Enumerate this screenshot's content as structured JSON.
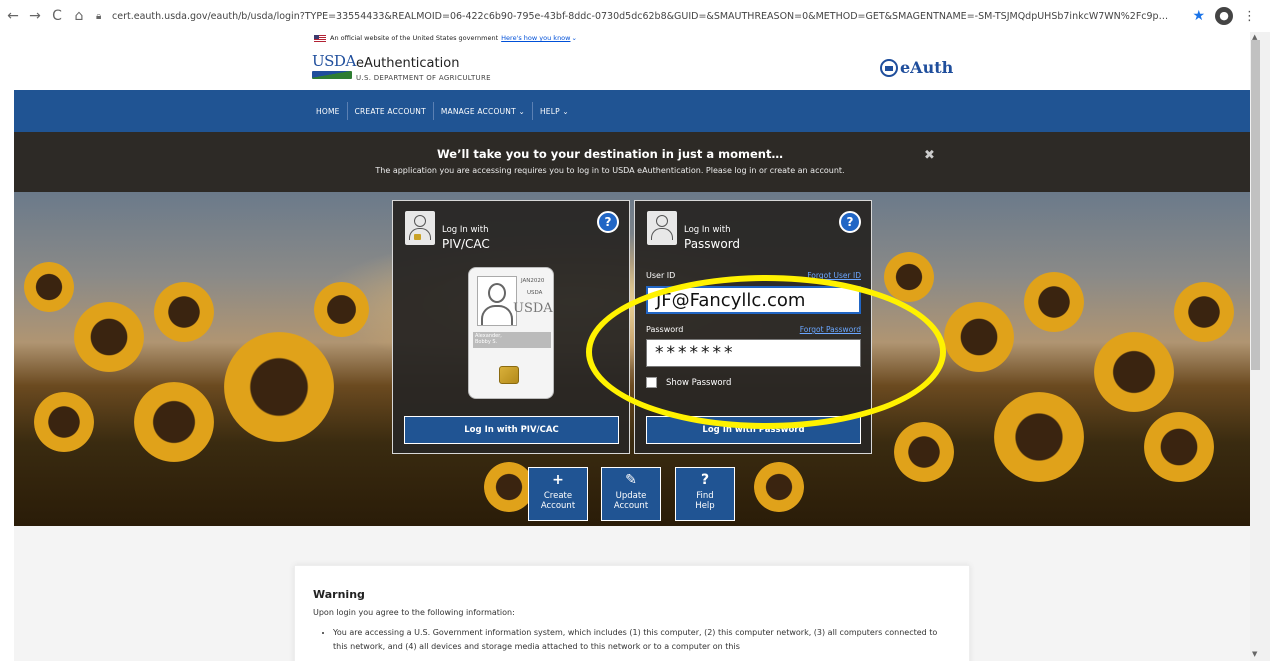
{
  "browser": {
    "back": "←",
    "forward": "→",
    "reload": "C",
    "home": "⌂",
    "url": "cert.eauth.usda.gov/eauth/b/usda/login?TYPE=33554433&REALMOID=06-422c6b90-795e-43bf-8ddc-0730d5dc62b8&GUID=&SMAUTHREASON=0&METHOD=GET&SMAGENTNAME=-SM-TSJMQdpUHSb7inkcW7WN%2Fc9pOgJqQht%2FUveMkbK3TJDn9R4GM..."
  },
  "gov_banner": {
    "text": "An official website of the United States government",
    "link": "Here's how you know"
  },
  "header": {
    "logo_text": "USDA",
    "title": "eAuthentication",
    "subtitle": "U.S. DEPARTMENT OF AGRICULTURE",
    "brand": "eAuth"
  },
  "nav": {
    "items": [
      {
        "label": "HOME"
      },
      {
        "label": "CREATE ACCOUNT"
      },
      {
        "label": "MANAGE ACCOUNT ⌄"
      },
      {
        "label": "HELP ⌄"
      }
    ]
  },
  "notice": {
    "title": "We’ll take you to your destination in just a moment…",
    "text": "The application you are accessing requires you to log in to USDA eAuthentication. Please log in or create an account.",
    "close": "✖"
  },
  "piv_card": {
    "small": "Log In with",
    "big": "PIV/CAC",
    "help": "?",
    "id_date": "JAN2020",
    "id_usda_small": "USDA",
    "id_usda_large": "USDA",
    "id_name": "Alexander,\nBobby S.",
    "button": "Log In with PIV/CAC"
  },
  "password_card": {
    "small": "Log In with",
    "big": "Password",
    "help": "?",
    "user_id_label": "User ID",
    "forgot_user_id": "Forgot User ID",
    "user_id_value": "JF@Fancyllc.com",
    "password_label": "Password",
    "forgot_password": "Forgot Password",
    "password_value": "*******",
    "show_password": "Show Password",
    "button": "Log In with Password"
  },
  "quick_links": [
    {
      "icon": "+",
      "label1": "Create",
      "label2": "Account"
    },
    {
      "icon": "✎",
      "label1": "Update",
      "label2": "Account"
    },
    {
      "icon": "?",
      "label1": "Find",
      "label2": "Help"
    }
  ],
  "warning": {
    "title": "Warning",
    "intro": "Upon login you agree to the following information:",
    "item1": "You are accessing a U.S. Government information system, which includes (1) this computer, (2) this computer network, (3) all computers connected to this network, and (4) all devices and storage media attached to this network or to a computer on this"
  },
  "colors": {
    "nav_blue": "#205493",
    "notice_bg": "#2d2a26",
    "highlight": "#fff200"
  }
}
